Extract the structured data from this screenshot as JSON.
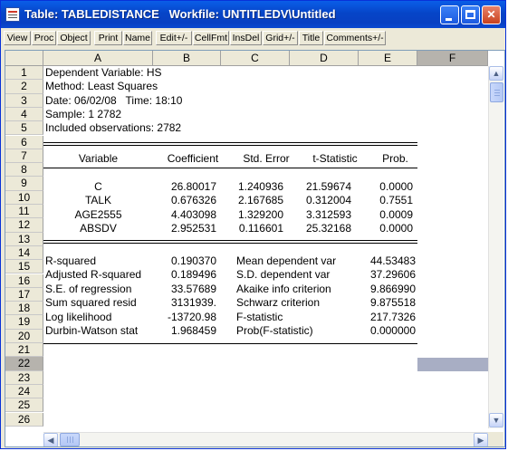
{
  "window": {
    "title": "Table: TABLEDISTANCE   Workfile: UNTITLEDV\\Untitled"
  },
  "toolbar": {
    "buttons": [
      "View",
      "Proc",
      "Object",
      "Print",
      "Name",
      "Edit+/-",
      "CellFmt",
      "InsDel",
      "Grid+/-",
      "Title",
      "Comments+/-"
    ]
  },
  "columns": [
    "A",
    "B",
    "C",
    "D",
    "E",
    "F"
  ],
  "selected_column": "F",
  "selected_row": "22",
  "rows": [
    "1",
    "2",
    "3",
    "4",
    "5",
    "6",
    "7",
    "8",
    "9",
    "10",
    "11",
    "12",
    "13",
    "14",
    "15",
    "16",
    "17",
    "18",
    "19",
    "20",
    "21",
    "22",
    "23",
    "24",
    "25",
    "26"
  ],
  "header_lines": [
    "Dependent Variable: HS",
    "Method: Least Squares",
    "Date: 06/02/08   Time: 18:10",
    "Sample: 1 2782",
    "Included observations: 2782"
  ],
  "coef_table": {
    "headers": [
      "Variable",
      "Coefficient",
      "Std. Error",
      "t-Statistic",
      "Prob."
    ],
    "rows": [
      {
        "variable": "C",
        "coefficient": "26.80017",
        "std_error": "1.240936",
        "t_stat": "21.59674",
        "prob": "0.0000"
      },
      {
        "variable": "TALK",
        "coefficient": "0.676326",
        "std_error": "2.167685",
        "t_stat": "0.312004",
        "prob": "0.7551"
      },
      {
        "variable": "AGE2555",
        "coefficient": "4.403098",
        "std_error": "1.329200",
        "t_stat": "3.312593",
        "prob": "0.0009"
      },
      {
        "variable": "ABSDV",
        "coefficient": "2.952531",
        "std_error": "0.116601",
        "t_stat": "25.32168",
        "prob": "0.0000"
      }
    ]
  },
  "stats": [
    {
      "label": "R-squared",
      "value": "0.190370",
      "label2": "Mean dependent var",
      "value2": "44.53483"
    },
    {
      "label": "Adjusted R-squared",
      "value": "0.189496",
      "label2": "S.D. dependent var",
      "value2": "37.29606"
    },
    {
      "label": "S.E. of regression",
      "value": "33.57689",
      "label2": "Akaike info criterion",
      "value2": "9.866990"
    },
    {
      "label": "Sum squared resid",
      "value": "3131939.",
      "label2": "Schwarz criterion",
      "value2": "9.875518"
    },
    {
      "label": "Log likelihood",
      "value": "-13720.98",
      "label2": "F-statistic",
      "value2": "217.7326"
    },
    {
      "label": "Durbin-Watson stat",
      "value": "1.968459",
      "label2": "Prob(F-statistic)",
      "value2": "0.000000"
    }
  ],
  "icons": {
    "app": "table-icon",
    "minimize": "minimize-icon",
    "maximize": "maximize-icon",
    "close": "close-icon",
    "scroll_up": "arrow-up-icon",
    "scroll_down": "arrow-down-icon",
    "scroll_left": "arrow-left-icon",
    "scroll_right": "arrow-right-icon"
  },
  "colors": {
    "titlebar": "#0645c8",
    "selection": "#a8aec4",
    "header_selected": "#b6b3ad"
  }
}
